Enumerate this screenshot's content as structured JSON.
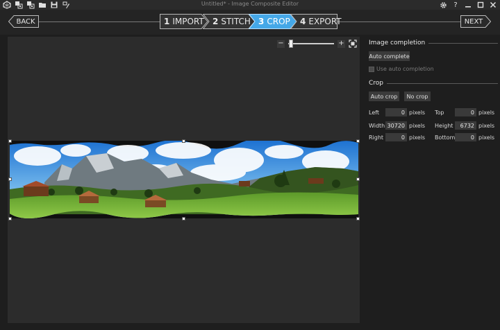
{
  "window": {
    "title": "Untitled* - Image Composite Editor"
  },
  "nav": {
    "back_label": "BACK",
    "next_label": "NEXT",
    "steps": [
      {
        "num": "1",
        "label": "IMPORT",
        "active": false
      },
      {
        "num": "2",
        "label": "STITCH",
        "active": false
      },
      {
        "num": "3",
        "label": "CROP",
        "active": true
      },
      {
        "num": "4",
        "label": "EXPORT",
        "active": false
      }
    ]
  },
  "zoom": {
    "minus": "−",
    "plus": "+",
    "level": 0.02
  },
  "panel": {
    "completion": {
      "heading": "Image completion",
      "auto_complete_label": "Auto complete",
      "use_auto_label": "Use auto completion",
      "use_auto_checked": false
    },
    "crop": {
      "heading": "Crop",
      "auto_crop_label": "Auto crop",
      "no_crop_label": "No crop",
      "unit": "pixels",
      "fields": {
        "left": {
          "label": "Left",
          "value": "0"
        },
        "top": {
          "label": "Top",
          "value": "0"
        },
        "width": {
          "label": "Width",
          "value": "30720"
        },
        "height": {
          "label": "Height",
          "value": "6732"
        },
        "right": {
          "label": "Right",
          "value": "0"
        },
        "bottom": {
          "label": "Bottom",
          "value": "0"
        }
      }
    }
  },
  "colors": {
    "accent": "#45a8e8",
    "background": "#1e1e1e",
    "canvas": "#2c2c2c"
  }
}
